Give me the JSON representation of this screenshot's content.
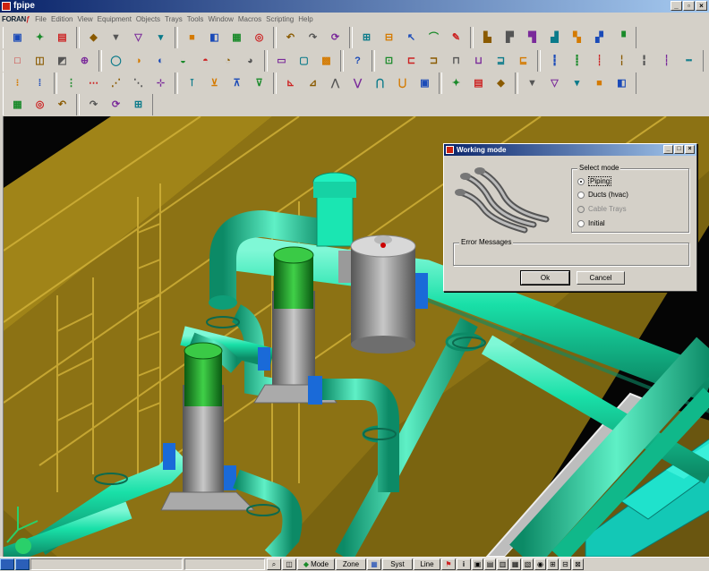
{
  "window": {
    "title": "fpipe"
  },
  "menu": {
    "logo_main": "FORAN",
    "logo_suffix": "ƒ",
    "items": [
      "File",
      "Edition",
      "View",
      "Equipment",
      "Objects",
      "Trays",
      "Tools",
      "Window",
      "Macros",
      "Scripting",
      "Help"
    ]
  },
  "toolbar_rows": [
    [
      "bench-icon",
      "wand-icon",
      "graph-icon",
      "nbcs-icon",
      "funnel-icon",
      "funnel-x-icon",
      "funnel-red-icon",
      "save-icon",
      "clip-icon",
      "grid-icon",
      "binoculars-icon",
      "undo-icon",
      "redo-icon",
      "refresh-icon",
      "plan-icon",
      "plan-arrow-icon",
      "cursor-icon",
      "bend-icon",
      "pen-icon",
      "equip1-icon",
      "equip2-icon",
      "equip3-icon",
      "equip4-icon",
      "equip5-icon",
      "equip6-icon",
      "equip7-icon"
    ],
    [
      "view1-icon",
      "view2-icon",
      "view3-icon",
      "view4-icon",
      "cyl1-icon",
      "cyl2-icon",
      "cyl3-icon",
      "cyl4-icon",
      "cyl5-icon",
      "cyl6-icon",
      "cyl7-icon",
      "frame1-icon",
      "frame2-icon",
      "frame3-icon",
      "help-box-icon",
      "box1-icon",
      "box2-icon",
      "box3-icon",
      "box4-icon",
      "box5-icon",
      "box6-icon",
      "box7-icon",
      "route1-icon",
      "route2-icon",
      "route3-icon",
      "route4-icon",
      "route5-icon",
      "route6-icon",
      "route7-icon"
    ],
    [
      "dots1-icon",
      "dots2-icon",
      "pin1-icon",
      "pin2-icon",
      "pin3-icon",
      "pin4-icon",
      "pin5-icon",
      "link1-icon",
      "link2-icon",
      "link3-icon",
      "link4-icon",
      "tool1-icon",
      "tool2-icon",
      "tool3-icon",
      "tool4-icon",
      "tool5-icon",
      "tool6-icon",
      "tool7-icon",
      "tool8-icon",
      "tool9-icon",
      "tool10-icon",
      "tool11-icon",
      "tool12-icon",
      "tool13-icon",
      "tool14-icon",
      "tool15-icon"
    ],
    [
      "rk1-icon",
      "rk2-icon",
      "rk3-icon",
      "stamp1-icon",
      "stamp2-icon",
      "stamp3-icon"
    ]
  ],
  "dialog": {
    "title": "Working mode",
    "select_mode_legend": "Select mode",
    "options": [
      {
        "label": "Piping",
        "selected": true,
        "enabled": true
      },
      {
        "label": "Ducts (hvac)",
        "selected": false,
        "enabled": true
      },
      {
        "label": "Cable Trays",
        "selected": false,
        "enabled": false
      },
      {
        "label": "Initial",
        "selected": false,
        "enabled": true
      }
    ],
    "error_legend": "Error Messages",
    "ok_label": "Ok",
    "cancel_label": "Cancel"
  },
  "statusbar": {
    "mode_label": "Mode",
    "zone_label": "Zone",
    "syst_label": "Syst",
    "line_label": "Line"
  },
  "colors": {
    "pipe": "#19e0a8",
    "pump_top": "#19a82a",
    "pump_body": "#8a8a8a",
    "flange": "#1a6ad8",
    "hull": "#e0c040",
    "background": "#050505",
    "title_bar": "#0a246a"
  }
}
